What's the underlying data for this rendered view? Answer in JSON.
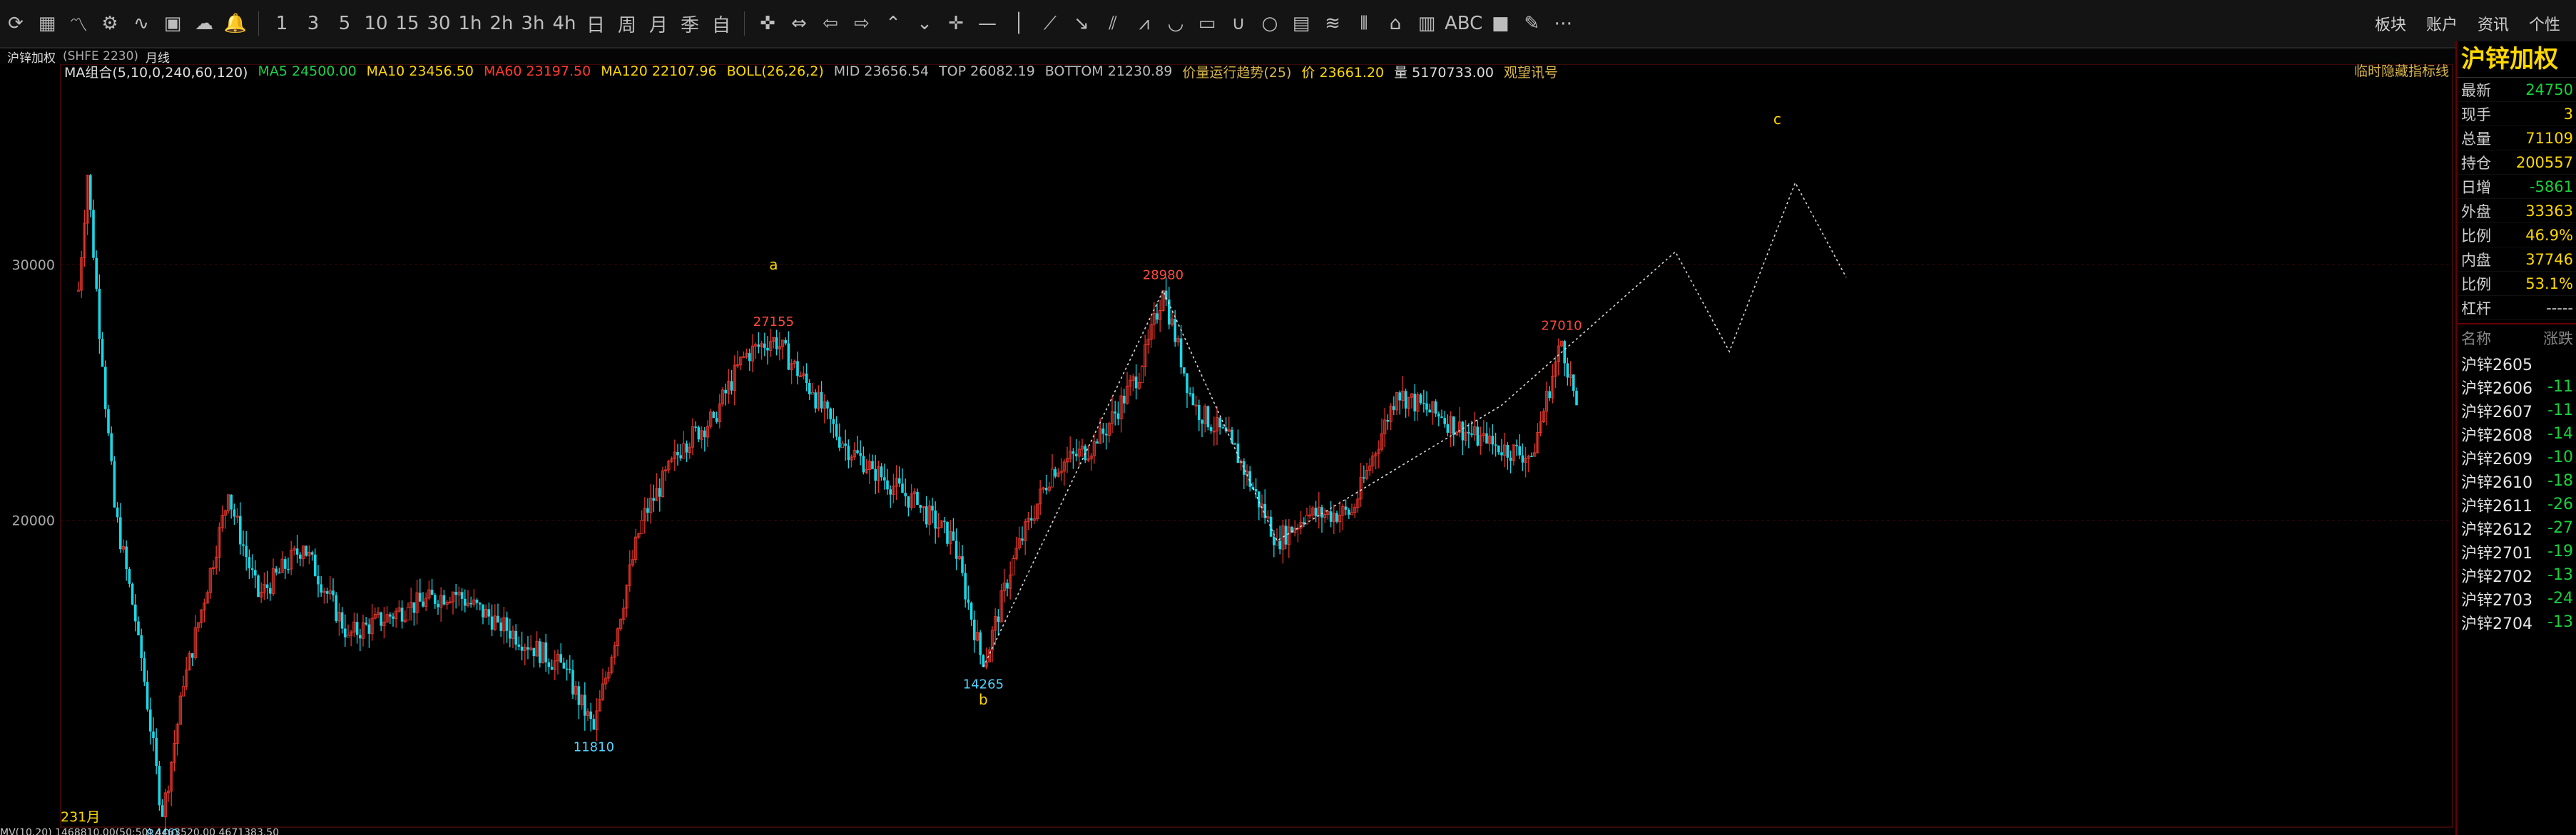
{
  "toolbar": {
    "tools": [
      {
        "name": "refresh-icon",
        "glyph": "⟳"
      },
      {
        "name": "table-icon",
        "glyph": "▦"
      },
      {
        "name": "line-chart-icon",
        "glyph": "〽"
      },
      {
        "name": "indicator-icon",
        "glyph": "⚙"
      },
      {
        "name": "formula-icon",
        "glyph": "∿"
      },
      {
        "name": "window-icon",
        "glyph": "▣"
      },
      {
        "name": "cloud-icon",
        "glyph": "☁"
      },
      {
        "name": "bell-icon",
        "glyph": "🔔"
      }
    ],
    "periods": [
      "1",
      "3",
      "5",
      "10",
      "15",
      "30",
      "1h",
      "2h",
      "3h",
      "4h",
      "日",
      "周",
      "月",
      "季",
      "自"
    ],
    "draw_tools": [
      {
        "name": "cross-icon",
        "glyph": "✜"
      },
      {
        "name": "double-arrow-icon",
        "glyph": "⇔"
      },
      {
        "name": "arrow-left-icon",
        "glyph": "⇦"
      },
      {
        "name": "arrow-right-icon",
        "glyph": "⇨"
      },
      {
        "name": "chevron-up-icon",
        "glyph": "⌃"
      },
      {
        "name": "chevron-down-icon",
        "glyph": "⌄"
      },
      {
        "name": "crosshair-icon",
        "glyph": "✛"
      },
      {
        "name": "hline-icon",
        "glyph": "—"
      },
      {
        "name": "vline-icon",
        "glyph": "│"
      },
      {
        "name": "segment-icon",
        "glyph": "⟋"
      },
      {
        "name": "ray-icon",
        "glyph": "↘"
      },
      {
        "name": "channel-icon",
        "glyph": "⫽"
      },
      {
        "name": "zigzag-icon",
        "glyph": "⩘"
      },
      {
        "name": "arc-icon",
        "glyph": "◡"
      },
      {
        "name": "rect-icon",
        "glyph": "▭"
      },
      {
        "name": "u-shape-icon",
        "glyph": "∪"
      },
      {
        "name": "circle-icon",
        "glyph": "○"
      },
      {
        "name": "gann-icon",
        "glyph": "▤"
      },
      {
        "name": "fibonacci-icon",
        "glyph": "≋"
      },
      {
        "name": "bars-icon",
        "glyph": "⦀"
      },
      {
        "name": "home-icon",
        "glyph": "⌂"
      },
      {
        "name": "period-bars-icon",
        "glyph": "▥"
      },
      {
        "name": "text-tool-icon",
        "glyph": "ABC"
      },
      {
        "name": "color-swatch-icon",
        "glyph": "■"
      },
      {
        "name": "pen-icon",
        "glyph": "✎"
      },
      {
        "name": "more-icon",
        "glyph": "⋯"
      }
    ],
    "right_links": [
      "板块",
      "账户",
      "资讯",
      "个性"
    ]
  },
  "info": {
    "symbol": "沪锌加权",
    "code": "(SHFE 2230)",
    "period": "月线"
  },
  "legend": {
    "ma_group": "MA组合(5,10,0,240,60,120)",
    "ma5": "MA5 24500.00",
    "ma10": "MA10 23456.50",
    "ma60": "MA60 23197.50",
    "ma120": "MA120 22107.96",
    "boll": "BOLL(26,26,2)",
    "mid": "MID 23656.54",
    "top": "TOP 26082.19",
    "bottom": "BOTTOM 21230.89",
    "trend": "价量运行趋势(25)",
    "price": "价 23661.20",
    "volume": "量 5170733.00",
    "signal": "观望讯号",
    "hide_hint": "临时隐藏指标线"
  },
  "panel": {
    "title": "沪锌加权",
    "quotes": [
      {
        "label": "最新",
        "value": "24750",
        "color": "#18d23c"
      },
      {
        "label": "现手",
        "value": "3",
        "color": "#ffd800"
      },
      {
        "label": "总量",
        "value": "71109",
        "color": "#ffd800"
      },
      {
        "label": "持仓",
        "value": "200557",
        "color": "#ffd800"
      },
      {
        "label": "日增",
        "value": "-5861",
        "color": "#18d23c"
      },
      {
        "label": "外盘",
        "value": "33363",
        "color": "#ffd800"
      },
      {
        "label": "比例",
        "value": "46.9%",
        "color": "#ffd800"
      },
      {
        "label": "内盘",
        "value": "37746",
        "color": "#ffd800"
      },
      {
        "label": "比例",
        "value": "53.1%",
        "color": "#ffd800"
      },
      {
        "label": "杠杆",
        "value": "-----",
        "color": "#cfcfcf"
      }
    ],
    "list_header": {
      "name": "名称",
      "change": "涨跌"
    },
    "contracts": [
      {
        "name": "沪锌2605",
        "change": ""
      },
      {
        "name": "沪锌2606",
        "change": "-11"
      },
      {
        "name": "沪锌2607",
        "change": "-11"
      },
      {
        "name": "沪锌2608",
        "change": "-14"
      },
      {
        "name": "沪锌2609",
        "change": "-10"
      },
      {
        "name": "沪锌2610",
        "change": "-18"
      },
      {
        "name": "沪锌2611",
        "change": "-26"
      },
      {
        "name": "沪锌2612",
        "change": "-27"
      },
      {
        "name": "沪锌2701",
        "change": "-19"
      },
      {
        "name": "沪锌2702",
        "change": "-13"
      },
      {
        "name": "沪锌2703",
        "change": "-24"
      },
      {
        "name": "沪锌2704",
        "change": "-13"
      }
    ]
  },
  "bottom_bar": {
    "text": "MV(10,20)  1468810.00(50:50)  4463520.00  4671383.50"
  },
  "chart_data": {
    "type": "candlestick",
    "ylim": [
      8000,
      37000
    ],
    "y_ticks": [
      20000,
      30000
    ],
    "period": "月线",
    "x_label_left": "231月",
    "colors": {
      "up": "#e0352b",
      "down": "#1ad7e6",
      "grid": "#3a0808",
      "wave": "#d9d9d9"
    },
    "anchors": [
      [
        0,
        29000
      ],
      [
        3,
        33500
      ],
      [
        8,
        26000
      ],
      [
        12,
        20500
      ],
      [
        20,
        15500
      ],
      [
        28,
        8400
      ],
      [
        35,
        13500
      ],
      [
        50,
        21000
      ],
      [
        60,
        17000
      ],
      [
        75,
        19000
      ],
      [
        90,
        15500
      ],
      [
        110,
        16600
      ],
      [
        125,
        17200
      ],
      [
        140,
        16000
      ],
      [
        162,
        14200
      ],
      [
        172,
        11810
      ],
      [
        188,
        20000
      ],
      [
        202,
        23000
      ],
      [
        212,
        24000
      ],
      [
        222,
        26400
      ],
      [
        232,
        27155
      ],
      [
        245,
        25000
      ],
      [
        255,
        23000
      ],
      [
        265,
        22000
      ],
      [
        280,
        20600
      ],
      [
        292,
        19200
      ],
      [
        302,
        14265
      ],
      [
        312,
        18500
      ],
      [
        325,
        22000
      ],
      [
        340,
        23000
      ],
      [
        355,
        26000
      ],
      [
        362,
        28980
      ],
      [
        372,
        24500
      ],
      [
        385,
        23000
      ],
      [
        400,
        19200
      ],
      [
        410,
        20200
      ],
      [
        425,
        20300
      ],
      [
        440,
        25000
      ],
      [
        455,
        24000
      ],
      [
        470,
        23000
      ],
      [
        485,
        22500
      ],
      [
        495,
        27010
      ],
      [
        500,
        24500
      ]
    ],
    "swing_labels": [
      {
        "i": 28,
        "value": 8400,
        "text": "8400",
        "pos": "below",
        "color": "#4fd4ff"
      },
      {
        "i": 172,
        "value": 11810,
        "text": "11810",
        "pos": "below",
        "color": "#4fd4ff"
      },
      {
        "i": 232,
        "value": 27155,
        "text": "27155",
        "pos": "above",
        "color": "#ff4a3d"
      },
      {
        "i": 302,
        "value": 14265,
        "text": "14265",
        "pos": "below",
        "color": "#4fd4ff"
      },
      {
        "i": 362,
        "value": 28980,
        "text": "28980",
        "pos": "above",
        "color": "#ff4a3d"
      },
      {
        "i": 495,
        "value": 27010,
        "text": "27010",
        "pos": "above",
        "color": "#ff4a3d"
      }
    ],
    "wave_labels": [
      {
        "text": "a",
        "i": 232,
        "value": 29800
      },
      {
        "text": "b",
        "i": 302,
        "value": 12800
      },
      {
        "text": "c",
        "i": 567,
        "value": 35500
      }
    ],
    "wave_path": [
      [
        302,
        14265
      ],
      [
        362,
        28980
      ],
      [
        400,
        19200
      ],
      [
        475,
        24500
      ],
      [
        533,
        30500
      ],
      [
        551,
        26600
      ],
      [
        573,
        33200
      ],
      [
        590,
        29500
      ]
    ]
  }
}
